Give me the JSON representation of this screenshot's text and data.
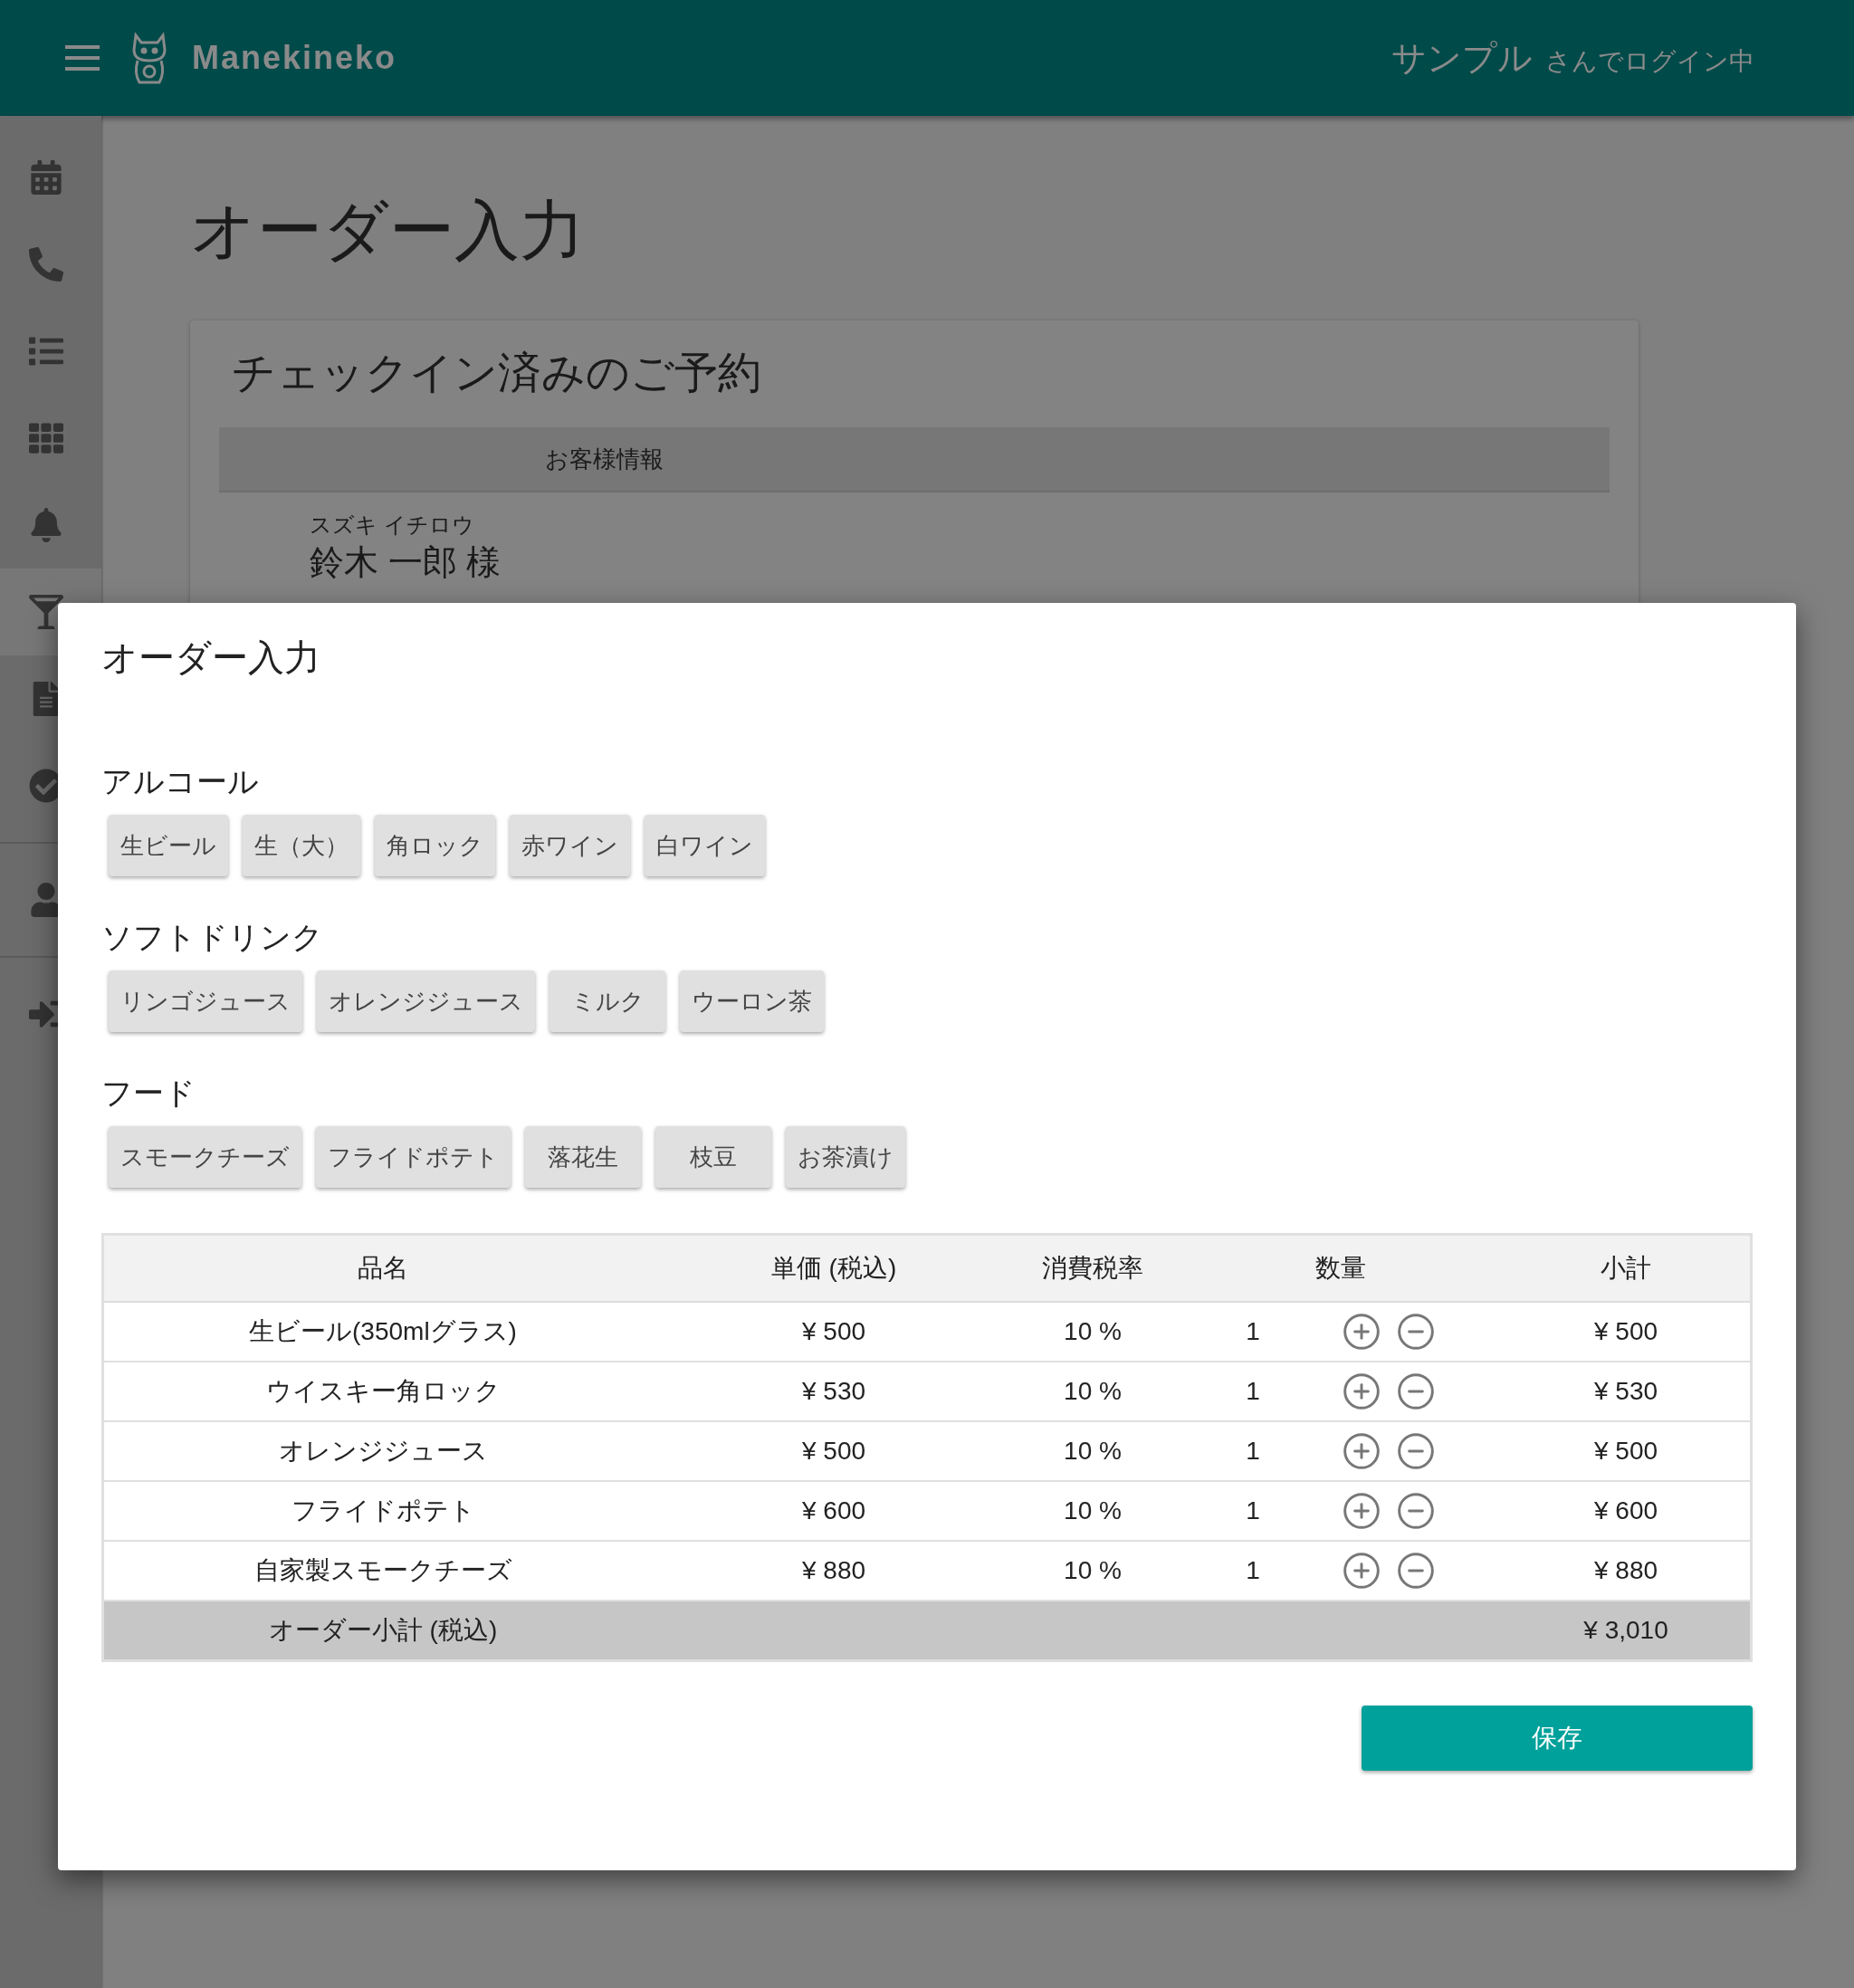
{
  "header": {
    "logo_text": "Manekineko",
    "user_name": "サンプル",
    "login_suffix": "さんでログイン中"
  },
  "sidebar": {
    "groups": [
      [
        {
          "selected": false
        },
        {
          "selected": false
        },
        {
          "selected": false
        },
        {
          "selected": false
        },
        {
          "selected": false
        },
        {
          "selected": true
        },
        {
          "selected": false
        },
        {
          "selected": false
        }
      ],
      [
        {
          "selected": false
        }
      ],
      [
        {
          "selected": false
        }
      ]
    ]
  },
  "page": {
    "title": "オーダー入力",
    "card": {
      "title": "チェックイン済みのご予約",
      "info_header": "お客様情報",
      "customer_kana": "スズキ イチロウ",
      "customer_name": "鈴木 一郎 様"
    }
  },
  "dialog": {
    "title": "オーダー入力",
    "categories": [
      {
        "name": "アルコール",
        "items": [
          "生ビール",
          "生（大）",
          "角ロック",
          "赤ワイン",
          "白ワイン"
        ]
      },
      {
        "name": "ソフトドリンク",
        "items": [
          "リンゴジュース",
          "オレンジジュース",
          "ミルク",
          "ウーロン茶"
        ]
      },
      {
        "name": "フード",
        "items": [
          "スモークチーズ",
          "フライドポテト",
          "落花生",
          "枝豆",
          "お茶漬け"
        ]
      }
    ],
    "table": {
      "columns": [
        "品名",
        "単価 (税込)",
        "消費税率",
        "数量",
        "小計"
      ],
      "rows": [
        {
          "name": "生ビール(350mlグラス)",
          "price": "¥ 500",
          "tax": "10 %",
          "qty": "1",
          "subtotal": "¥ 500"
        },
        {
          "name": "ウイスキー角ロック",
          "price": "¥ 530",
          "tax": "10 %",
          "qty": "1",
          "subtotal": "¥ 530"
        },
        {
          "name": "オレンジジュース",
          "price": "¥ 500",
          "tax": "10 %",
          "qty": "1",
          "subtotal": "¥ 500"
        },
        {
          "name": "フライドポテト",
          "price": "¥ 600",
          "tax": "10 %",
          "qty": "1",
          "subtotal": "¥ 600"
        },
        {
          "name": "自家製スモークチーズ",
          "price": "¥ 880",
          "tax": "10 %",
          "qty": "1",
          "subtotal": "¥ 880"
        }
      ],
      "total": {
        "label": "オーダー小計 (税込)",
        "value": "¥ 3,010"
      }
    },
    "save_button": "保存"
  }
}
